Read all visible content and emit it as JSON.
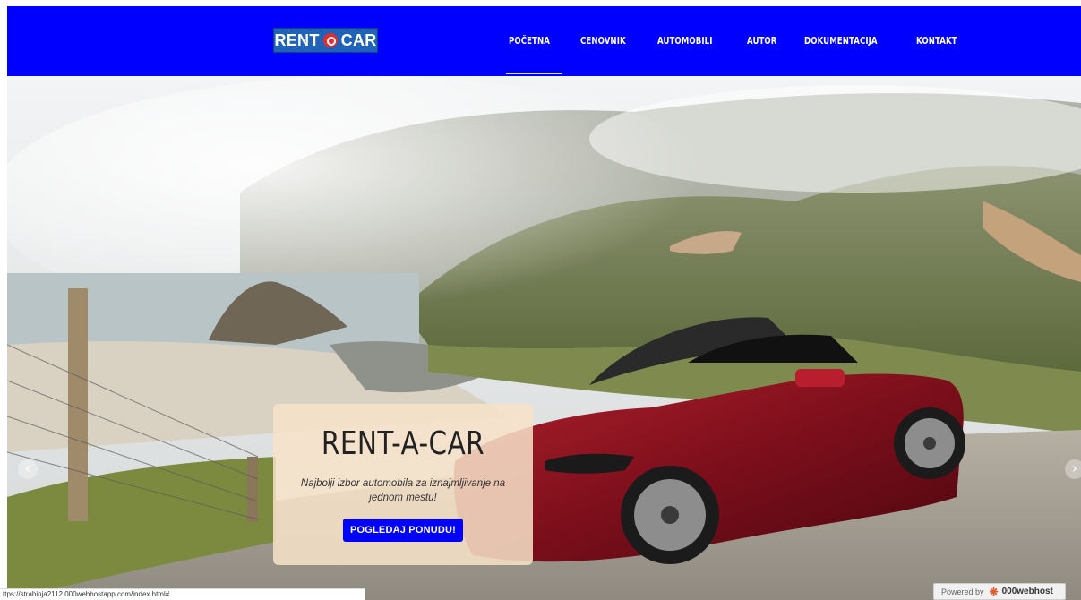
{
  "brand": {
    "logo_left": "RENT",
    "logo_right": "CAR"
  },
  "nav": {
    "items": [
      {
        "label": "POČETNA"
      },
      {
        "label": "CENOVNIK"
      },
      {
        "label": "AUTOMOBILI"
      },
      {
        "label": "AUTOR"
      },
      {
        "label": "DOKUMENTACIJA"
      },
      {
        "label": "KONTAKT"
      }
    ],
    "active": "POČETNA"
  },
  "hero": {
    "title": "RENT-A-CAR",
    "tagline": "Najbolji izbor automobila za iznajmljivanje na jednom mestu!",
    "cta_label": "POGLEDAJ PONUDU!",
    "prev_glyph": "‹",
    "next_glyph": "›"
  },
  "status": {
    "url": "ttps://strahinja2112.000webhostapp.com/index.html#"
  },
  "badge": {
    "powered_by": "Powered by",
    "host": "000webhost"
  },
  "colors": {
    "navbar": "#0000ff",
    "cta": "#0000ff",
    "caption_bg": "#f7e2c8",
    "logo_mark": "#e52b2b"
  }
}
